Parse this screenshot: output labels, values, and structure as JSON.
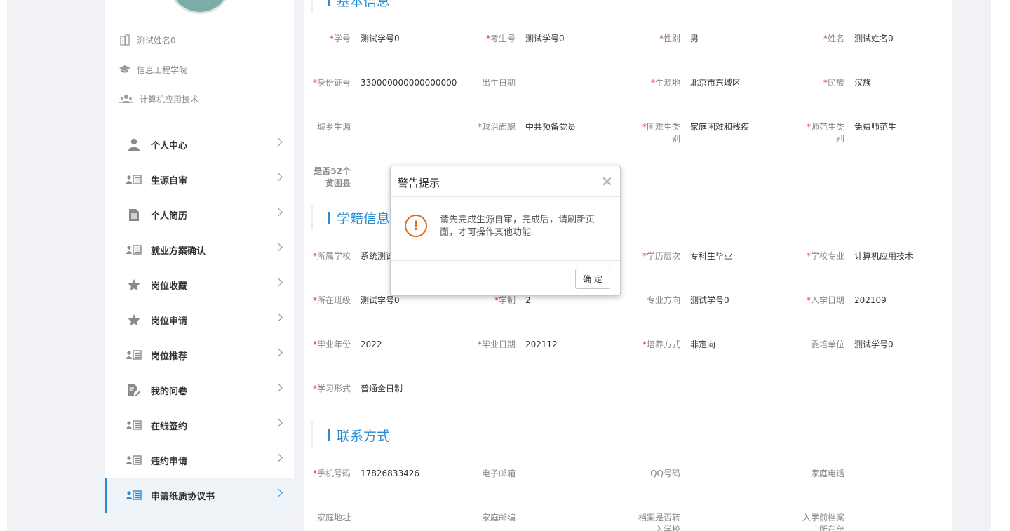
{
  "profile": {
    "name": "测试姓名0",
    "college": "信息工程学院",
    "major": "计算机应用技术"
  },
  "menu": [
    {
      "label": "个人中心",
      "icon": "person-icon"
    },
    {
      "label": "生源自审",
      "icon": "id-card-list-icon"
    },
    {
      "label": "个人简历",
      "icon": "document-icon"
    },
    {
      "label": "就业方案确认",
      "icon": "id-card-list-icon"
    },
    {
      "label": "岗位收藏",
      "icon": "star-icon"
    },
    {
      "label": "岗位申请",
      "icon": "star-icon"
    },
    {
      "label": "岗位推荐",
      "icon": "id-card-list-icon"
    },
    {
      "label": "我的问卷",
      "icon": "edit-document-icon"
    },
    {
      "label": "在线签约",
      "icon": "id-card-list-icon"
    },
    {
      "label": "违约申请",
      "icon": "id-card-list-icon"
    },
    {
      "label": "申请纸质协议书",
      "icon": "id-card-list-icon",
      "active": true
    }
  ],
  "sections": {
    "basic": {
      "title": "基本信息"
    },
    "school": {
      "title": "学籍信息"
    },
    "contact": {
      "title": "联系方式"
    }
  },
  "fields": {
    "f1": {
      "label": "学号",
      "value": "测试学号0",
      "required": "*"
    },
    "f2": {
      "label": "考生号",
      "value": "测试学号0",
      "required": "*"
    },
    "f3": {
      "label": "性别",
      "value": "男",
      "required": "*"
    },
    "f4": {
      "label": "姓名",
      "value": "测试姓名0",
      "required": "*"
    },
    "f5": {
      "label": "身份证号",
      "value": "330000000000000000",
      "required": "*"
    },
    "f6": {
      "label": "出生日期",
      "value": "",
      "required": ""
    },
    "f7": {
      "label": "生源地",
      "value": "北京市东城区",
      "required": "*"
    },
    "f8": {
      "label": "民族",
      "value": "汉族",
      "required": "*"
    },
    "f9": {
      "label": "城乡生源",
      "value": "",
      "required": ""
    },
    "f10": {
      "label": "政治面貌",
      "value": "中共预备党员",
      "required": "*"
    },
    "f11": {
      "label": "困难生类别",
      "value": "家庭困难和残疾",
      "required": "*"
    },
    "f12": {
      "label": "师范生类别",
      "value": "免费师范生",
      "required": "*"
    },
    "f13": {
      "label": "是否52个贫困县",
      "value": "",
      "required": ""
    },
    "s1": {
      "label": "所属学校",
      "value": "系统测试",
      "required": "*"
    },
    "s3": {
      "label": "学历层次",
      "value": "专科生毕业",
      "required": "*"
    },
    "s4": {
      "label": "学校专业",
      "value": "计算机应用技术",
      "required": "*"
    },
    "s5": {
      "label": "所在班级",
      "value": "测试学号0",
      "required": "*"
    },
    "s6": {
      "label": "学制",
      "value": "2",
      "required": "*"
    },
    "s7": {
      "label": "专业方向",
      "value": "测试学号0",
      "required": ""
    },
    "s8": {
      "label": "入学日期",
      "value": "202109",
      "required": "*"
    },
    "s9": {
      "label": "毕业年份",
      "value": "2022",
      "required": "*"
    },
    "s10": {
      "label": "毕业日期",
      "value": "202112",
      "required": "*"
    },
    "s11": {
      "label": "培养方式",
      "value": "非定向",
      "required": "*"
    },
    "s12": {
      "label": "委培单位",
      "value": "测试学号0",
      "required": ""
    },
    "s13": {
      "label": "学习形式",
      "value": "普通全日制",
      "required": "*"
    },
    "c1": {
      "label": "手机号码",
      "value": "17826833426",
      "required": "*"
    },
    "c2": {
      "label": "电子邮箱",
      "value": "",
      "required": ""
    },
    "c3": {
      "label": "QQ号码",
      "value": "",
      "required": ""
    },
    "c4": {
      "label": "家庭电话",
      "value": "",
      "required": ""
    },
    "c5": {
      "label": "家庭地址",
      "value": "",
      "required": ""
    },
    "c6": {
      "label": "家庭邮编",
      "value": "",
      "required": ""
    },
    "c7": {
      "label": "档案是否转入学校",
      "value": "",
      "required": ""
    },
    "c8": {
      "label": "入学前档案所在单",
      "value": "",
      "required": ""
    }
  },
  "dialog": {
    "title": "警告提示",
    "close": "×",
    "icon_text": "!",
    "message": "请先完成生源自审，完成后，请刷新页面，才可操作其他功能",
    "ok_label": "确 定"
  },
  "colors": {
    "accent": "#2a8bd3",
    "required": "#e03030",
    "warning": "#e06a1a"
  }
}
